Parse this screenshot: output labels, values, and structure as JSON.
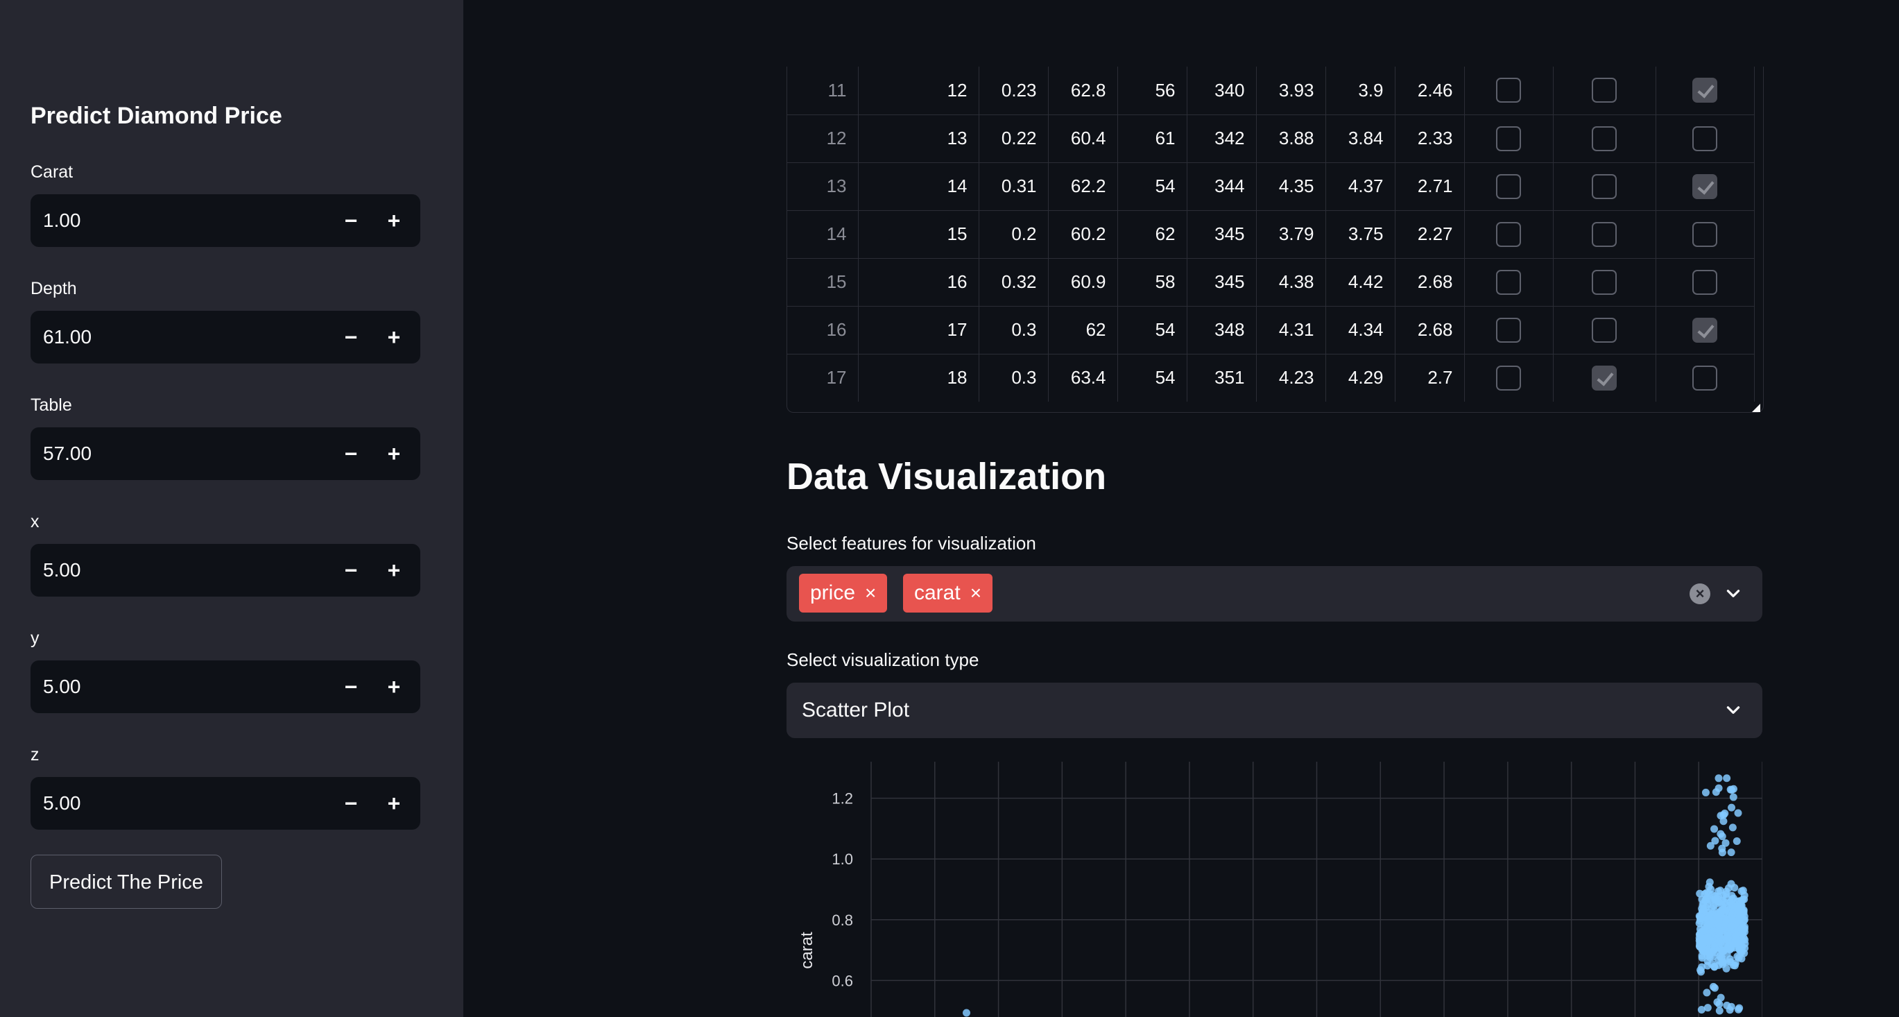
{
  "sidebar": {
    "title": "Predict Diamond Price",
    "fields": [
      {
        "label": "Carat",
        "value": "1.00"
      },
      {
        "label": "Depth",
        "value": "61.00"
      },
      {
        "label": "Table",
        "value": "57.00"
      },
      {
        "label": "x",
        "value": "5.00"
      },
      {
        "label": "y",
        "value": "5.00"
      },
      {
        "label": "z",
        "value": "5.00"
      }
    ],
    "stepper": {
      "minus": "−",
      "plus": "+"
    },
    "predict_button": "Predict The Price"
  },
  "table": {
    "rows": [
      {
        "index": "11",
        "cells": [
          "12",
          "0.23",
          "62.8",
          "56",
          "340",
          "3.93",
          "3.9",
          "2.46"
        ],
        "checks": [
          false,
          false,
          true
        ]
      },
      {
        "index": "12",
        "cells": [
          "13",
          "0.22",
          "60.4",
          "61",
          "342",
          "3.88",
          "3.84",
          "2.33"
        ],
        "checks": [
          false,
          false,
          false
        ]
      },
      {
        "index": "13",
        "cells": [
          "14",
          "0.31",
          "62.2",
          "54",
          "344",
          "4.35",
          "4.37",
          "2.71"
        ],
        "checks": [
          false,
          false,
          true
        ]
      },
      {
        "index": "14",
        "cells": [
          "15",
          "0.2",
          "60.2",
          "62",
          "345",
          "3.79",
          "3.75",
          "2.27"
        ],
        "checks": [
          false,
          false,
          false
        ]
      },
      {
        "index": "15",
        "cells": [
          "16",
          "0.32",
          "60.9",
          "58",
          "345",
          "4.38",
          "4.42",
          "2.68"
        ],
        "checks": [
          false,
          false,
          false
        ]
      },
      {
        "index": "16",
        "cells": [
          "17",
          "0.3",
          "62",
          "54",
          "348",
          "4.31",
          "4.34",
          "2.68"
        ],
        "checks": [
          false,
          false,
          true
        ]
      },
      {
        "index": "17",
        "cells": [
          "18",
          "0.3",
          "63.4",
          "54",
          "351",
          "4.23",
          "4.29",
          "2.7"
        ],
        "checks": [
          false,
          true,
          false
        ]
      }
    ]
  },
  "visualization": {
    "title": "Data Visualization",
    "features_label": "Select features for visualization",
    "selected_features": [
      "price",
      "carat"
    ],
    "type_label": "Select visualization type",
    "type_value": "Scatter Plot"
  },
  "chart_data": {
    "type": "scatter",
    "title": "",
    "xlabel": "",
    "ylabel": "carat",
    "ylim": [
      0.48,
      1.32
    ],
    "y_ticks": [
      "1.2",
      "1.0",
      "0.8",
      "0.6"
    ],
    "point_color": "#83c9ff",
    "clusters": [
      {
        "x_frac": 0.955,
        "y_center": 0.78,
        "y_spread": 0.09,
        "note": "dense column"
      }
    ]
  },
  "colors": {
    "background": "#0e1117",
    "sidebar": "#262730",
    "tag": "#e8544f",
    "accent_points": "#83c9ff"
  }
}
